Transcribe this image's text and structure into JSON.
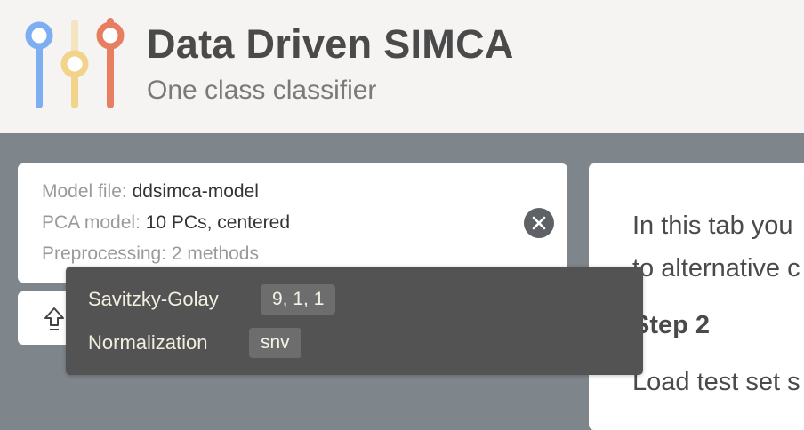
{
  "header": {
    "title": "Data Driven SIMCA",
    "subtitle": "One class classifier",
    "logo_colors": [
      "#7daef2",
      "#f1d38a",
      "#e67e5f"
    ]
  },
  "model_card": {
    "model_file_label": "Model file:",
    "model_file_value": "ddsimca-model",
    "pca_label": "PCA model:",
    "pca_value": "10 PCs, centered",
    "preprocessing_label": "Preprocessing:",
    "preprocessing_value": "2 methods",
    "close_icon": "close-icon"
  },
  "upload_button": {
    "icon": "upload-icon"
  },
  "tooltip": {
    "items": [
      {
        "label": "Savitzky-Golay",
        "value": "9, 1, 1"
      },
      {
        "label": "Normalization",
        "value": "snv"
      }
    ]
  },
  "right_panel": {
    "line1": "In this tab you",
    "line2": "to alternative c",
    "step_title": "Step 2",
    "line3": "Load test set s"
  }
}
